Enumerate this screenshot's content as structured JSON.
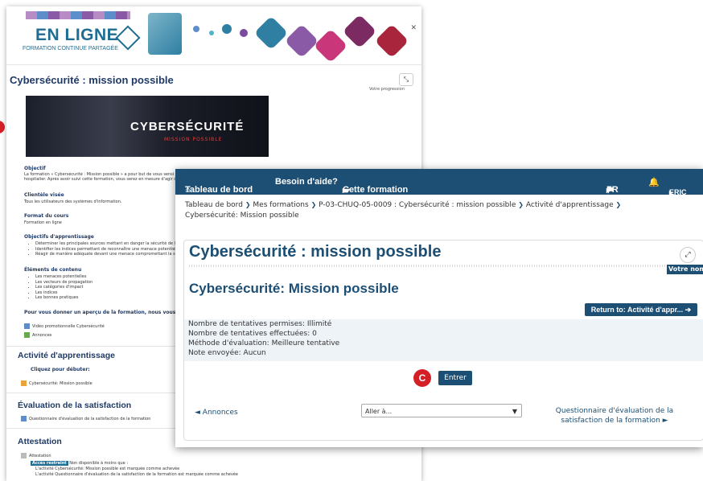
{
  "background": {
    "brand": {
      "title": "EN LIGNE",
      "subtitle": "FORMATION CONTINUE PARTAGÉE"
    },
    "course_title": "Cybersécurité : mission possible",
    "progress_label": "Votre progression",
    "banner": {
      "title": "CYBERSÉCURITÉ",
      "subtitle": "MISSION POSSIBLE"
    },
    "sections": {
      "objectif": {
        "title": "Objectif",
        "text": "La formation « Cybersécurité : Mission possible » a pour but de vous sensi"
      },
      "objectif_line2": "hospitalier. Après avoir suivi cette formation, vous serez en mesure d'agir de m",
      "clientele": {
        "title": "Clientèle visée",
        "text": "Tous les utilisateurs des systèmes d'information."
      },
      "format": {
        "title": "Format du cours",
        "text": "Formation en ligne"
      },
      "objectifs_app": {
        "title": "Objectifs d'apprentissage",
        "items": [
          "Déterminer les principales sources mettant en danger la sécurité de l'infor",
          "Identifier les indices permettant de reconnaître une menace potentielle.",
          "Réagir de manière adéquate devant une menace compromettant la sécurit"
        ]
      },
      "elements": {
        "title": "Éléments de contenu",
        "items": [
          "Les menaces potentielles",
          "Les vecteurs de propagation",
          "Les catégories d'impact",
          "Les indices",
          "Les bonnes pratiques"
        ]
      },
      "apercu": "Pour vous donner un aperçu de la formation, nous vous invitons à cons",
      "video": "Vidéo promotionnelle Cybersécurité",
      "annonces": "Annonces",
      "activite": {
        "title": "Activité d'apprentissage",
        "intro": "Cliquez pour débuter:",
        "item": "Cybersécurité: Mission possible"
      },
      "evaluation": {
        "title": "Évaluation de la satisfaction",
        "item": "Questionnaire d'évaluation de la satisfaction de la formation"
      },
      "attestation": {
        "title": "Attestation",
        "item": "Attestation",
        "badge": "Accès restreint",
        "restriction": "Non disponible à moins que :",
        "cond1": "L'activité Cybersécurité: Mission possible est marquée comme achevée",
        "cond2": "L'activité Questionnaire d'évaluation de la satisfaction de la formation est marquée comme achevée"
      }
    }
  },
  "navbar": {
    "dashboard": "Tableau de bord",
    "help": "Besoin d'aide?",
    "this_course": "Cette formation",
    "lang": "FR",
    "user": "ERIC"
  },
  "breadcrumb": [
    "Tableau de bord",
    "Mes formations",
    "P-03-CHUQ-05-0009 : Cybersécurité : mission possible",
    "Activité d'apprentissage",
    "Cybersécurité: Mission possible"
  ],
  "main": {
    "title": "Cybersécurité : mission possible",
    "name_tab": "Votre nom",
    "activity_title": "Cybersécurité: Mission possible",
    "return_button": "Return to: Activité d'appr...",
    "info": {
      "attempts_allowed": "Nombre de tentatives permises: Illimité",
      "attempts_made": "Nombre de tentatives effectuées: 0",
      "grading_method": "Méthode d'évaluation: Meilleure tentative",
      "grade_sent": "Note envoyée: Aucun"
    },
    "marker": "C",
    "enter_button": "Entrer",
    "prev_link": "◄ Annonces",
    "jump_select": "Aller à...",
    "next_link": "Questionnaire d'évaluation de la satisfaction de la formation ►"
  },
  "colors": {
    "navy": "#1d4e73",
    "red_marker": "#d51f26",
    "info_bg": "#eef3f8"
  }
}
